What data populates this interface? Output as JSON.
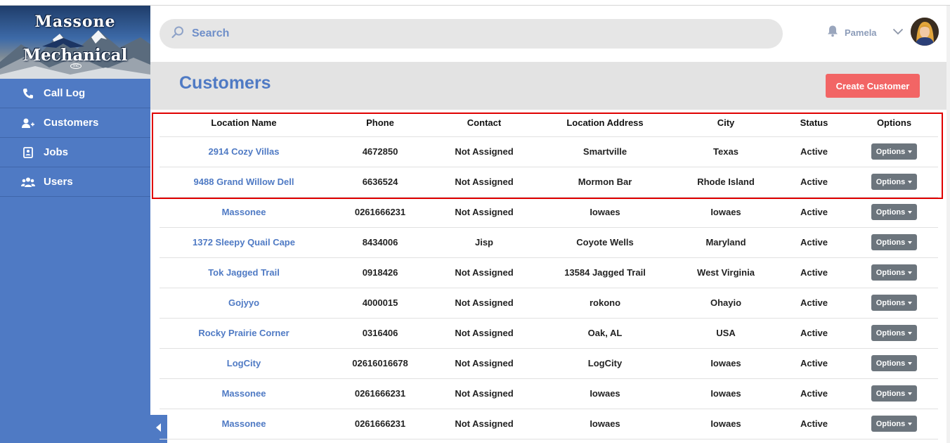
{
  "brand": {
    "logo_line1": "Massone",
    "logo_line2": "Mechanical",
    "logo_small": "Inc"
  },
  "sidebar": {
    "items": [
      {
        "label": "Call Log",
        "icon": "phone-icon"
      },
      {
        "label": "Customers",
        "icon": "add-user-icon"
      },
      {
        "label": "Jobs",
        "icon": "badge-icon"
      },
      {
        "label": "Users",
        "icon": "users-icon"
      }
    ]
  },
  "header": {
    "search_label": "Search",
    "user_name": "Pamela"
  },
  "page": {
    "title": "Customers",
    "create_button": "Create Customer"
  },
  "table": {
    "columns": [
      "Location Name",
      "Phone",
      "Contact",
      "Location Address",
      "City",
      "Status",
      "Options"
    ],
    "rows": [
      {
        "location": "2914 Cozy Villas",
        "phone": "4672850",
        "contact": "Not Assigned",
        "address": "Smartville",
        "city": "Texas",
        "status": "Active",
        "option": "Options"
      },
      {
        "location": "9488 Grand Willow Dell",
        "phone": "6636524",
        "contact": "Not Assigned",
        "address": "Mormon Bar",
        "city": "Rhode Island",
        "status": "Active",
        "option": "Options"
      },
      {
        "location": "Massonee",
        "phone": "0261666231",
        "contact": "Not Assigned",
        "address": "Iowaes",
        "city": "Iowaes",
        "status": "Active",
        "option": "Options"
      },
      {
        "location": "1372 Sleepy Quail Cape",
        "phone": "8434006",
        "contact": "Jisp",
        "address": "Coyote Wells",
        "city": "Maryland",
        "status": "Active",
        "option": "Options"
      },
      {
        "location": "Tok Jagged Trail",
        "phone": "0918426",
        "contact": "Not Assigned",
        "address": "13584 Jagged Trail",
        "city": "West Virginia",
        "status": "Active",
        "option": "Options"
      },
      {
        "location": "Gojyyo",
        "phone": "4000015",
        "contact": "Not Assigned",
        "address": "rokono",
        "city": "Ohayio",
        "status": "Active",
        "option": "Options"
      },
      {
        "location": "Rocky Prairie Corner",
        "phone": "0316406",
        "contact": "Not Assigned",
        "address": "Oak, AL",
        "city": "USA",
        "status": "Active",
        "option": "Options"
      },
      {
        "location": "LogCity",
        "phone": "02616016678",
        "contact": "Not Assigned",
        "address": "LogCity",
        "city": "Iowaes",
        "status": "Active",
        "option": "Options"
      },
      {
        "location": "Massonee",
        "phone": "0261666231",
        "contact": "Not Assigned",
        "address": "Iowaes",
        "city": "Iowaes",
        "status": "Active",
        "option": "Options"
      },
      {
        "location": "Massonee",
        "phone": "0261666231",
        "contact": "Not Assigned",
        "address": "Iowaes",
        "city": "Iowaes",
        "status": "Active",
        "option": "Options"
      }
    ]
  },
  "colors": {
    "sidebar": "#4f7ac4",
    "accent_link": "#4f7ac4",
    "create_button": "#f26565",
    "options_button": "#6c757d",
    "highlight_box": "#e00000"
  }
}
